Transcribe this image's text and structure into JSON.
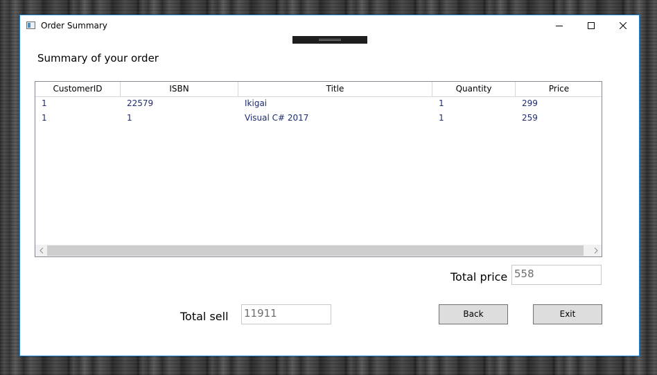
{
  "window": {
    "title": "Order Summary"
  },
  "heading": "Summary of your order",
  "table": {
    "columns": [
      "CustomerID",
      "ISBN",
      "Title",
      "Quantity",
      "Price"
    ],
    "rows": [
      [
        "1",
        "22579",
        "Ikigai",
        "1",
        "299"
      ],
      [
        "1",
        "1",
        "Visual C# 2017",
        "1",
        "259"
      ]
    ]
  },
  "total_price": {
    "label": "Total price",
    "value": "558"
  },
  "total_sell": {
    "label": "Total sell",
    "value": "11911"
  },
  "buttons": {
    "back": "Back",
    "exit": "Exit"
  },
  "icons": {
    "minimize": "minimize-icon",
    "maximize": "maximize-icon",
    "close": "close-icon",
    "scroll_left": "chevron-left-icon",
    "scroll_right": "chevron-right-icon"
  }
}
